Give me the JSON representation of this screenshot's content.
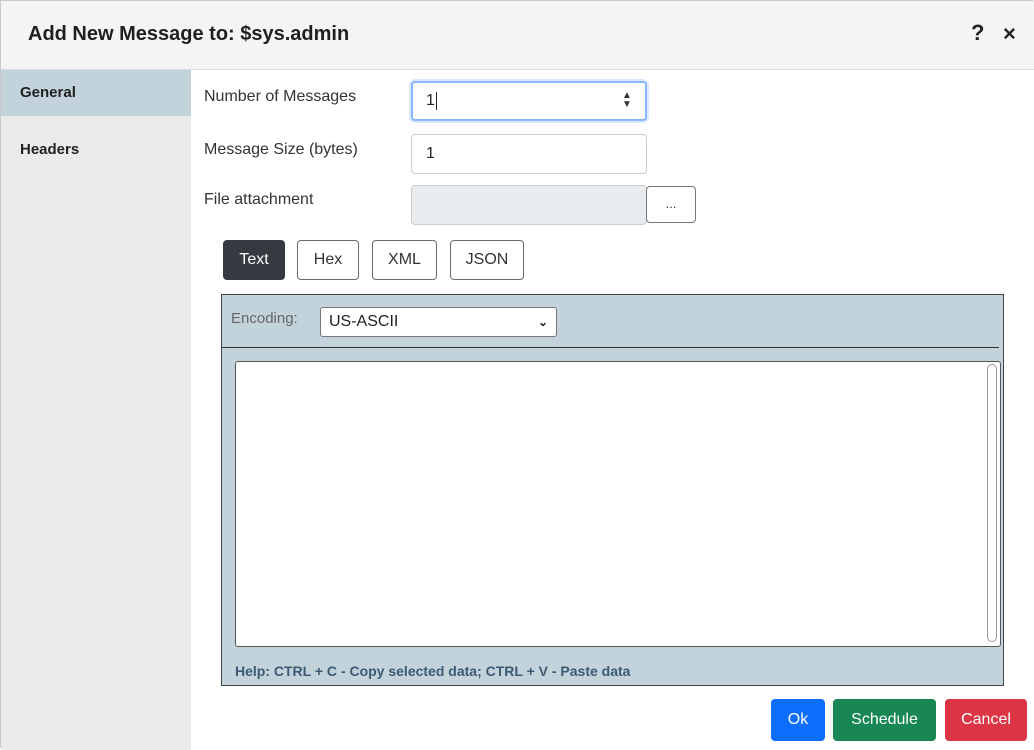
{
  "dialog": {
    "title": "Add New Message to: $sys.admin",
    "help_icon": "?",
    "close_icon": "×"
  },
  "sidebar": {
    "items": [
      {
        "label": "General",
        "active": true
      },
      {
        "label": "Headers",
        "active": false
      }
    ]
  },
  "form": {
    "num_messages": {
      "label": "Number of Messages",
      "value": "1"
    },
    "message_size": {
      "label": "Message Size (bytes)",
      "value": "1"
    },
    "file_attachment": {
      "label": "File attachment",
      "value": "",
      "browse_label": "..."
    }
  },
  "formats": [
    {
      "label": "Text",
      "active": true
    },
    {
      "label": "Hex",
      "active": false
    },
    {
      "label": "XML",
      "active": false
    },
    {
      "label": "JSON",
      "active": false
    }
  ],
  "editor": {
    "encoding_label": "Encoding:",
    "encoding_value": "US-ASCII",
    "content": "",
    "help": "Help: CTRL + C - Copy selected data; CTRL + V - Paste data"
  },
  "actions": {
    "ok": "Ok",
    "schedule": "Schedule",
    "cancel": "Cancel"
  },
  "colors": {
    "ok": "#0d6efd",
    "schedule": "#198754",
    "cancel": "#dc3545",
    "panel": "#c3d3dc"
  }
}
